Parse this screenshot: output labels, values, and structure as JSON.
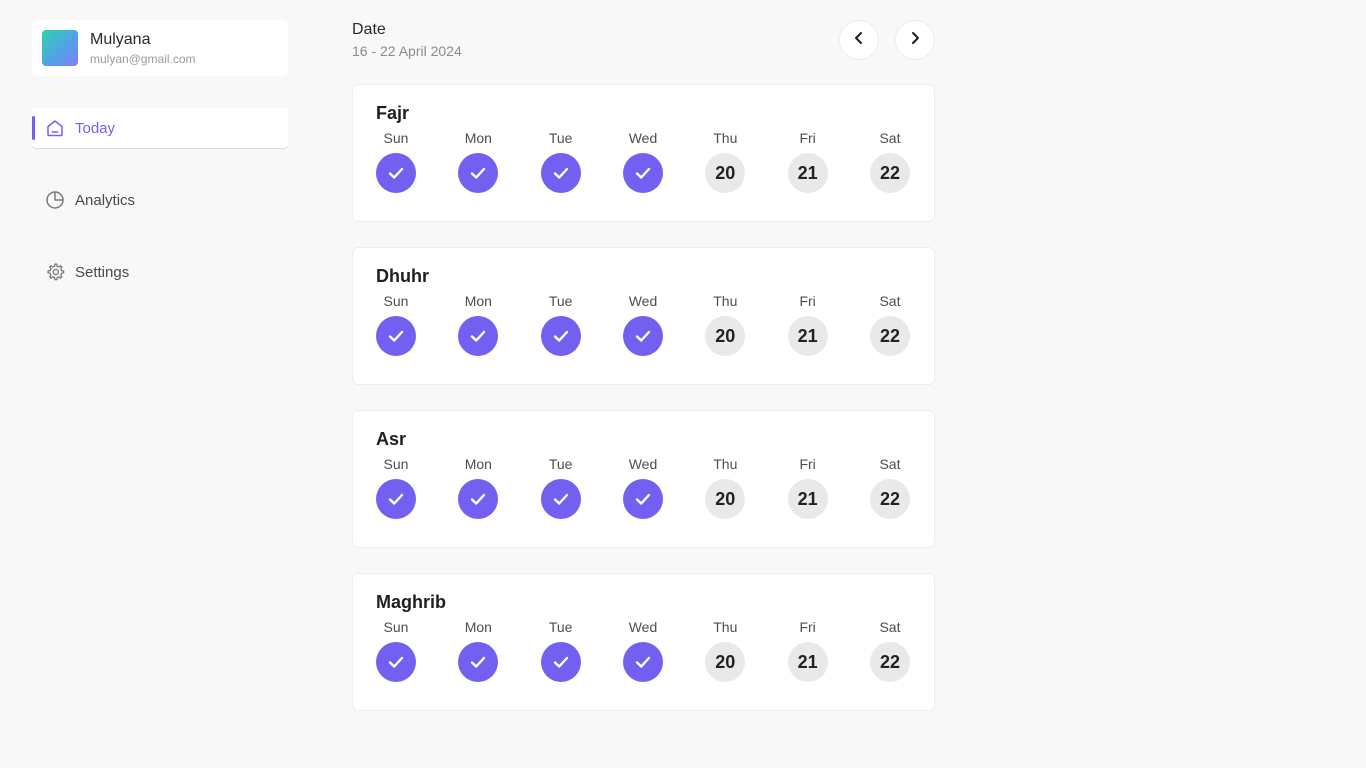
{
  "profile": {
    "name": "Mulyana",
    "email": "mulyan@gmail.com"
  },
  "nav": [
    {
      "label": "Today",
      "icon": "home-icon",
      "active": true
    },
    {
      "label": "Analytics",
      "icon": "pie-chart-icon",
      "active": false
    },
    {
      "label": "Settings",
      "icon": "gear-icon",
      "active": false
    }
  ],
  "header": {
    "label": "Date",
    "range": "16 - 22 April 2024",
    "prev_icon": "chevron-left-icon",
    "next_icon": "chevron-right-icon"
  },
  "prayers": [
    {
      "name": "Fajr",
      "days": [
        {
          "day": "Sun",
          "status": "done"
        },
        {
          "day": "Mon",
          "status": "done"
        },
        {
          "day": "Tue",
          "status": "done"
        },
        {
          "day": "Wed",
          "status": "done"
        },
        {
          "day": "Thu",
          "status": "pending",
          "date": "20"
        },
        {
          "day": "Fri",
          "status": "pending",
          "date": "21"
        },
        {
          "day": "Sat",
          "status": "pending",
          "date": "22"
        }
      ]
    },
    {
      "name": "Dhuhr",
      "days": [
        {
          "day": "Sun",
          "status": "done"
        },
        {
          "day": "Mon",
          "status": "done"
        },
        {
          "day": "Tue",
          "status": "done"
        },
        {
          "day": "Wed",
          "status": "done"
        },
        {
          "day": "Thu",
          "status": "pending",
          "date": "20"
        },
        {
          "day": "Fri",
          "status": "pending",
          "date": "21"
        },
        {
          "day": "Sat",
          "status": "pending",
          "date": "22"
        }
      ]
    },
    {
      "name": "Asr",
      "days": [
        {
          "day": "Sun",
          "status": "done"
        },
        {
          "day": "Mon",
          "status": "done"
        },
        {
          "day": "Tue",
          "status": "done"
        },
        {
          "day": "Wed",
          "status": "done"
        },
        {
          "day": "Thu",
          "status": "pending",
          "date": "20"
        },
        {
          "day": "Fri",
          "status": "pending",
          "date": "21"
        },
        {
          "day": "Sat",
          "status": "pending",
          "date": "22"
        }
      ]
    },
    {
      "name": "Maghrib",
      "days": [
        {
          "day": "Sun",
          "status": "done"
        },
        {
          "day": "Mon",
          "status": "done"
        },
        {
          "day": "Tue",
          "status": "done"
        },
        {
          "day": "Wed",
          "status": "done"
        },
        {
          "day": "Thu",
          "status": "pending",
          "date": "20"
        },
        {
          "day": "Fri",
          "status": "pending",
          "date": "21"
        },
        {
          "day": "Sat",
          "status": "pending",
          "date": "22"
        }
      ]
    }
  ],
  "colors": {
    "accent": "#7460f0",
    "pending": "#e9e9e9",
    "background": "#f8f8f8"
  }
}
